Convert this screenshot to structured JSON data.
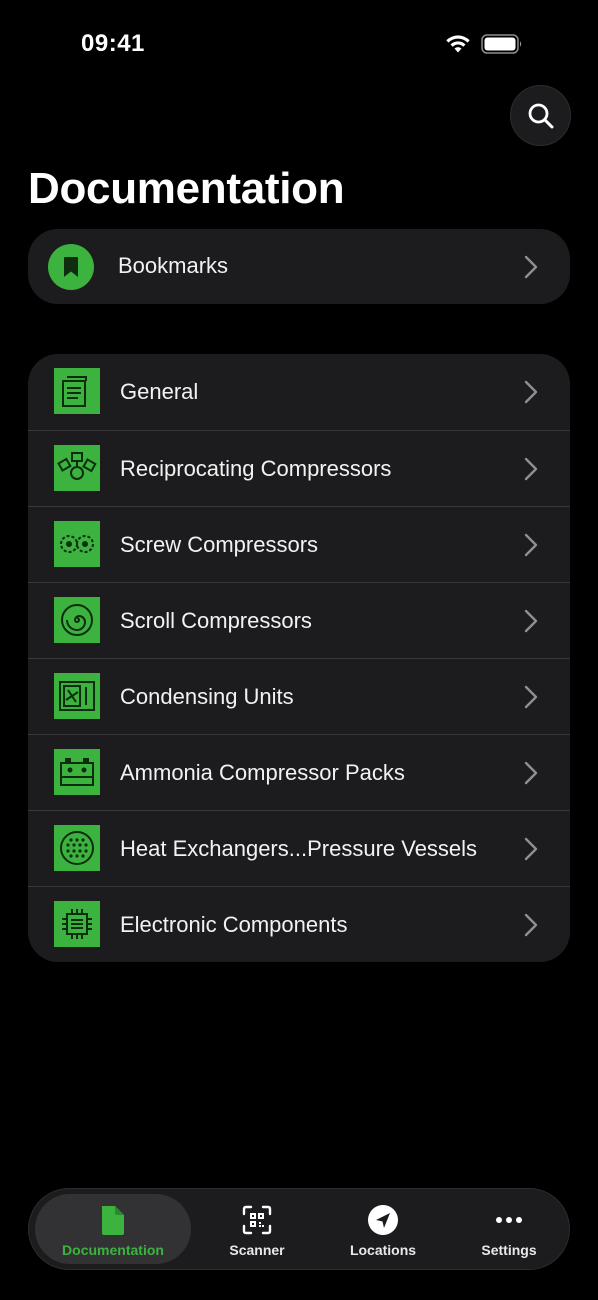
{
  "status_bar": {
    "time": "09:41"
  },
  "header": {
    "title": "Documentation"
  },
  "bookmarks": {
    "label": "Bookmarks"
  },
  "categories": [
    {
      "label": "General",
      "icon": "document-pages-icon"
    },
    {
      "label": "Reciprocating Compressors",
      "icon": "reciprocating-compressor-icon"
    },
    {
      "label": "Screw Compressors",
      "icon": "screw-compressor-icon"
    },
    {
      "label": "Scroll Compressors",
      "icon": "scroll-compressor-icon"
    },
    {
      "label": "Condensing Units",
      "icon": "condensing-unit-icon"
    },
    {
      "label": "Ammonia Compressor Packs",
      "icon": "compressor-pack-icon"
    },
    {
      "label": "Heat Exchangers...Pressure Vessels",
      "icon": "heat-exchanger-icon"
    },
    {
      "label": "Electronic Components",
      "icon": "chip-icon"
    }
  ],
  "tab_bar": {
    "tabs": [
      {
        "label": "Documentation",
        "icon": "document-icon",
        "active": true
      },
      {
        "label": "Scanner",
        "icon": "qr-scan-icon",
        "active": false
      },
      {
        "label": "Locations",
        "icon": "location-arrow-icon",
        "active": false
      },
      {
        "label": "Settings",
        "icon": "more-dots-icon",
        "active": false
      }
    ]
  },
  "colors": {
    "accent": "#3cb33e",
    "card": "#1c1c1e",
    "background": "#000000"
  }
}
